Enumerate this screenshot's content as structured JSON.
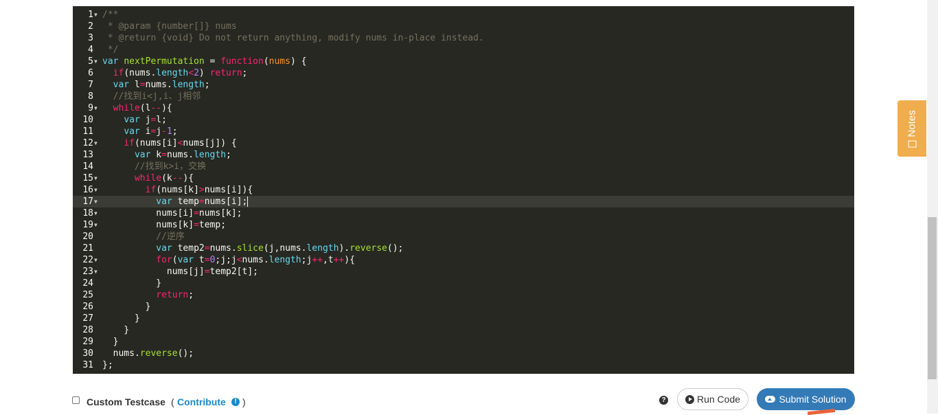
{
  "editor": {
    "lines": [
      {
        "n": "1",
        "fold": true,
        "tokens": [
          [
            "c",
            "/**"
          ]
        ]
      },
      {
        "n": "2",
        "fold": false,
        "tokens": [
          [
            "c",
            " * @param {number[]} nums"
          ]
        ]
      },
      {
        "n": "3",
        "fold": false,
        "tokens": [
          [
            "c",
            " * @return {void} Do not return anything, modify nums in-place instead."
          ]
        ]
      },
      {
        "n": "4",
        "fold": false,
        "tokens": [
          [
            "c",
            " */"
          ]
        ]
      },
      {
        "n": "5",
        "fold": true,
        "tokens": [
          [
            "s",
            "var "
          ],
          [
            "f",
            "nextPermutation"
          ],
          [
            "p",
            " = "
          ],
          [
            "k",
            "function"
          ],
          [
            "p",
            "("
          ],
          [
            "v",
            "nums"
          ],
          [
            "p",
            ") {"
          ]
        ]
      },
      {
        "n": "6",
        "fold": false,
        "tokens": [
          [
            "p",
            "  "
          ],
          [
            "k",
            "if"
          ],
          [
            "p",
            "(nums."
          ],
          [
            "s",
            "length"
          ],
          [
            "k",
            "<"
          ],
          [
            "n",
            "2"
          ],
          [
            "p",
            ") "
          ],
          [
            "k",
            "return"
          ],
          [
            "p",
            ";"
          ]
        ]
      },
      {
        "n": "7",
        "fold": false,
        "tokens": [
          [
            "p",
            "  "
          ],
          [
            "s",
            "var "
          ],
          [
            "p",
            "l"
          ],
          [
            "k",
            "="
          ],
          [
            "p",
            "nums."
          ],
          [
            "s",
            "length"
          ],
          [
            "p",
            ";"
          ]
        ]
      },
      {
        "n": "8",
        "fold": false,
        "tokens": [
          [
            "p",
            "  "
          ],
          [
            "c",
            "//找到i<j,i、j相邻"
          ]
        ]
      },
      {
        "n": "9",
        "fold": true,
        "tokens": [
          [
            "p",
            "  "
          ],
          [
            "k",
            "while"
          ],
          [
            "p",
            "(l"
          ],
          [
            "k",
            "--"
          ],
          [
            "p",
            "){"
          ]
        ]
      },
      {
        "n": "10",
        "fold": false,
        "tokens": [
          [
            "p",
            "    "
          ],
          [
            "s",
            "var "
          ],
          [
            "p",
            "j"
          ],
          [
            "k",
            "="
          ],
          [
            "p",
            "l;"
          ]
        ]
      },
      {
        "n": "11",
        "fold": false,
        "tokens": [
          [
            "p",
            "    "
          ],
          [
            "s",
            "var "
          ],
          [
            "p",
            "i"
          ],
          [
            "k",
            "="
          ],
          [
            "p",
            "j"
          ],
          [
            "k",
            "-"
          ],
          [
            "n",
            "1"
          ],
          [
            "p",
            ";"
          ]
        ]
      },
      {
        "n": "12",
        "fold": true,
        "tokens": [
          [
            "p",
            "    "
          ],
          [
            "k",
            "if"
          ],
          [
            "p",
            "(nums[i]"
          ],
          [
            "k",
            "<"
          ],
          [
            "p",
            "nums[j]) {"
          ]
        ]
      },
      {
        "n": "13",
        "fold": false,
        "tokens": [
          [
            "p",
            "      "
          ],
          [
            "s",
            "var "
          ],
          [
            "p",
            "k"
          ],
          [
            "k",
            "="
          ],
          [
            "p",
            "nums."
          ],
          [
            "s",
            "length"
          ],
          [
            "p",
            ";"
          ]
        ]
      },
      {
        "n": "14",
        "fold": false,
        "tokens": [
          [
            "p",
            "      "
          ],
          [
            "c",
            "//找到k>i，交换"
          ]
        ]
      },
      {
        "n": "15",
        "fold": true,
        "tokens": [
          [
            "p",
            "      "
          ],
          [
            "k",
            "while"
          ],
          [
            "p",
            "(k"
          ],
          [
            "k",
            "--"
          ],
          [
            "p",
            "){"
          ]
        ]
      },
      {
        "n": "16",
        "fold": true,
        "tokens": [
          [
            "p",
            "        "
          ],
          [
            "k",
            "if"
          ],
          [
            "p",
            "(nums[k]"
          ],
          [
            "k",
            ">"
          ],
          [
            "p",
            "nums[i]){"
          ]
        ]
      },
      {
        "n": "17",
        "fold": true,
        "active": true,
        "cursor": true,
        "tokens": [
          [
            "p",
            "          "
          ],
          [
            "s",
            "var "
          ],
          [
            "p",
            "temp"
          ],
          [
            "k",
            "="
          ],
          [
            "p",
            "nums[i];"
          ]
        ]
      },
      {
        "n": "18",
        "fold": true,
        "tokens": [
          [
            "p",
            "          nums[i]"
          ],
          [
            "k",
            "="
          ],
          [
            "p",
            "nums[k];"
          ]
        ]
      },
      {
        "n": "19",
        "fold": true,
        "tokens": [
          [
            "p",
            "          nums[k]"
          ],
          [
            "k",
            "="
          ],
          [
            "p",
            "temp;"
          ]
        ]
      },
      {
        "n": "20",
        "fold": false,
        "tokens": [
          [
            "p",
            "          "
          ],
          [
            "c",
            "//逆序"
          ]
        ]
      },
      {
        "n": "21",
        "fold": false,
        "tokens": [
          [
            "p",
            "          "
          ],
          [
            "s",
            "var "
          ],
          [
            "p",
            "temp2"
          ],
          [
            "k",
            "="
          ],
          [
            "p",
            "nums."
          ],
          [
            "f",
            "slice"
          ],
          [
            "p",
            "(j,nums."
          ],
          [
            "s",
            "length"
          ],
          [
            "p",
            ")."
          ],
          [
            "f",
            "reverse"
          ],
          [
            "p",
            "();"
          ]
        ]
      },
      {
        "n": "22",
        "fold": true,
        "tokens": [
          [
            "p",
            "          "
          ],
          [
            "k",
            "for"
          ],
          [
            "p",
            "("
          ],
          [
            "s",
            "var "
          ],
          [
            "p",
            "t"
          ],
          [
            "k",
            "="
          ],
          [
            "n",
            "0"
          ],
          [
            "p",
            ";j;j"
          ],
          [
            "k",
            "<"
          ],
          [
            "p",
            "nums."
          ],
          [
            "s",
            "length"
          ],
          [
            "p",
            ";j"
          ],
          [
            "k",
            "++"
          ],
          [
            "p",
            ",t"
          ],
          [
            "k",
            "++"
          ],
          [
            "p",
            "){"
          ]
        ]
      },
      {
        "n": "23",
        "fold": true,
        "tokens": [
          [
            "p",
            "            nums[j]"
          ],
          [
            "k",
            "="
          ],
          [
            "p",
            "temp2[t];"
          ]
        ]
      },
      {
        "n": "24",
        "fold": false,
        "tokens": [
          [
            "p",
            "          }"
          ]
        ]
      },
      {
        "n": "25",
        "fold": false,
        "tokens": [
          [
            "p",
            "          "
          ],
          [
            "k",
            "return"
          ],
          [
            "p",
            ";"
          ]
        ]
      },
      {
        "n": "26",
        "fold": false,
        "tokens": [
          [
            "p",
            "        }"
          ]
        ]
      },
      {
        "n": "27",
        "fold": false,
        "tokens": [
          [
            "p",
            "      }"
          ]
        ]
      },
      {
        "n": "28",
        "fold": false,
        "tokens": [
          [
            "p",
            "    }"
          ]
        ]
      },
      {
        "n": "29",
        "fold": false,
        "tokens": [
          [
            "p",
            "  }"
          ]
        ]
      },
      {
        "n": "30",
        "fold": false,
        "tokens": [
          [
            "p",
            "  nums."
          ],
          [
            "f",
            "reverse"
          ],
          [
            "p",
            "();"
          ]
        ]
      },
      {
        "n": "31",
        "fold": false,
        "tokens": [
          [
            "p",
            "};"
          ]
        ]
      }
    ]
  },
  "notes": {
    "label": "Notes"
  },
  "footer": {
    "custom_testcase_label": "Custom Testcase",
    "open_paren": "(",
    "contribute_label": "Contribute",
    "close_paren": ")",
    "run_label": "Run Code",
    "submit_label": "Submit Solution"
  },
  "colors": {
    "accent": "#337ab7",
    "notes": "#f0ad4e",
    "link": "#1a8ac6"
  }
}
